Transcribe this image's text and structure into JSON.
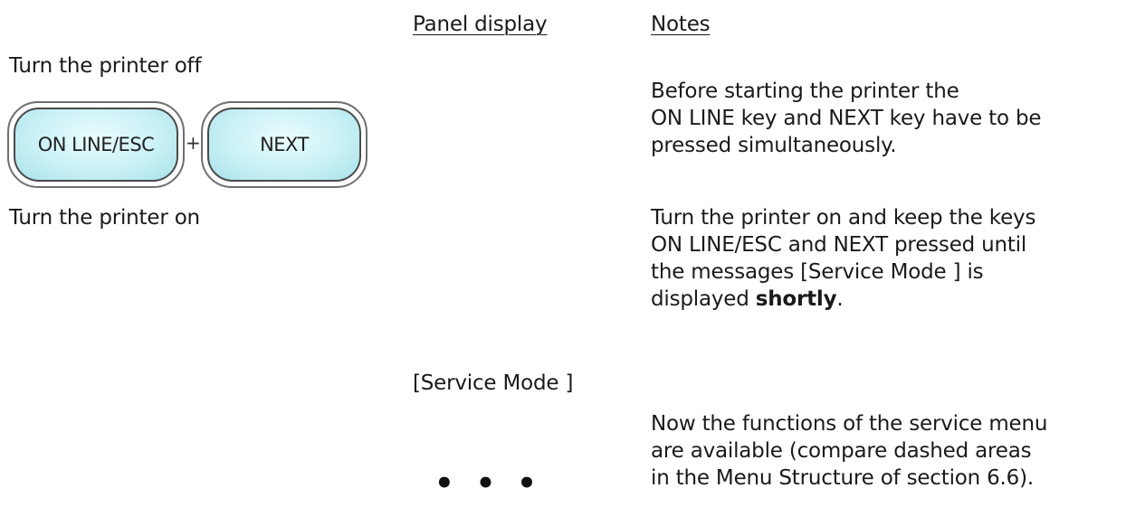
{
  "headers": {
    "panel_display": "Panel display",
    "notes": "Notes"
  },
  "steps": [
    {
      "action": "Turn the printer off"
    },
    {
      "action": "Turn the printer on"
    }
  ],
  "keys": {
    "online_esc": "ON LINE/ESC",
    "plus": "+",
    "next": "NEXT"
  },
  "panel": {
    "service_mode": "[Service Mode ]",
    "ellipsis": "• • •"
  },
  "notes": {
    "note1": [
      "Before starting the printer the",
      "ON LINE key and NEXT key have to be",
      "pressed simultaneously."
    ],
    "note2_lines": [
      "Turn the printer on and keep the keys",
      "ON LINE/ESC and NEXT pressed until",
      "the messages [Service Mode ] is"
    ],
    "note2_last_prefix": "displayed ",
    "note2_last_bold": "shortly",
    "note2_last_suffix": ".",
    "note3": [
      "Now the functions of the service menu",
      "are available (compare dashed areas",
      "in the Menu Structure of section 6.6)."
    ]
  }
}
